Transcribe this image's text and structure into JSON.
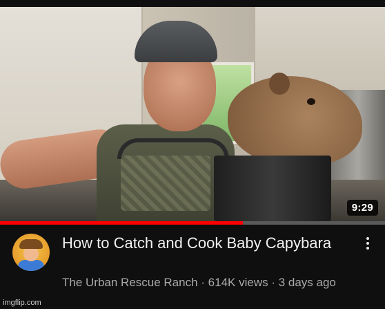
{
  "video": {
    "duration": "9:29",
    "progress_fraction": 0.63
  },
  "channel": {
    "avatar_icon": "channel-avatar-cartoon"
  },
  "title": "How to Catch and Cook Baby Capybara",
  "meta": {
    "channel_name": "The Urban Rescue Ranch",
    "views": "614K views",
    "age": "3 days ago",
    "separator": " · "
  },
  "watermark": "imgflip.com",
  "colors": {
    "background": "#0f0f0f",
    "progress": "#ff0000",
    "title_text": "#f1f1f1",
    "meta_text": "#aaaaaa"
  }
}
